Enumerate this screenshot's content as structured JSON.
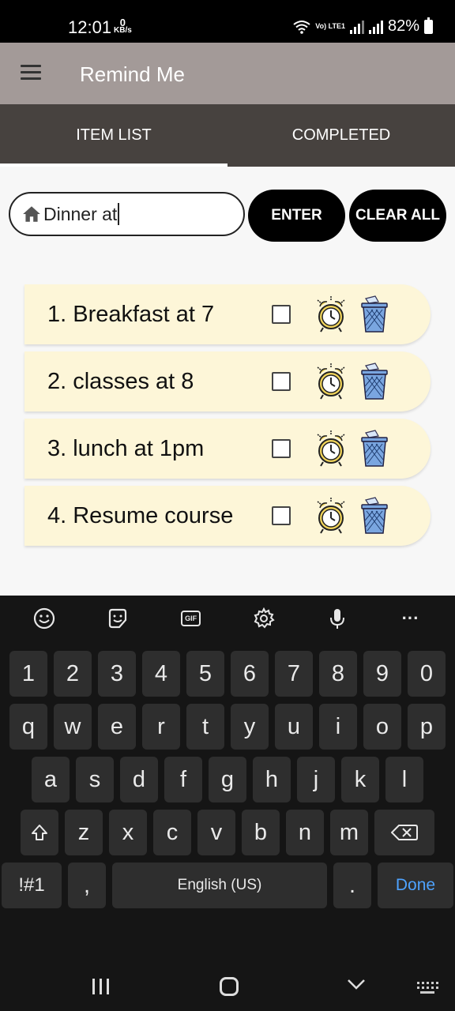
{
  "status_bar": {
    "time": "12:01",
    "net_speed_value": "0",
    "net_speed_unit": "KB/s",
    "volte_label": "Vo) LTE1",
    "battery": "82%"
  },
  "app_bar": {
    "title": "Remind Me",
    "menu_icon": "hamburger-menu-icon"
  },
  "tabs": [
    {
      "label": "ITEM LIST",
      "active": true
    },
    {
      "label": "COMPLETED",
      "active": false
    }
  ],
  "input": {
    "value": "Dinner at",
    "icon": "home-icon"
  },
  "buttons": {
    "enter": "ENTER",
    "clear_all": "CLEAR ALL"
  },
  "items": [
    {
      "text": "1. Breakfast at 7",
      "checked": false
    },
    {
      "text": "2. classes at 8",
      "checked": false
    },
    {
      "text": "3. lunch at 1pm",
      "checked": false
    },
    {
      "text": "4. Resume course",
      "checked": false
    }
  ],
  "keyboard": {
    "toolbar": [
      "emoji-icon",
      "sticker-icon",
      "gif-icon",
      "settings-icon",
      "microphone-icon",
      "more-icon"
    ],
    "gif_label": "GIF",
    "more_label": "···",
    "row1": [
      "1",
      "2",
      "3",
      "4",
      "5",
      "6",
      "7",
      "8",
      "9",
      "0"
    ],
    "row2": [
      "q",
      "w",
      "e",
      "r",
      "t",
      "y",
      "u",
      "i",
      "o",
      "p"
    ],
    "row3": [
      "a",
      "s",
      "d",
      "f",
      "g",
      "h",
      "j",
      "k",
      "l"
    ],
    "row4": [
      "z",
      "x",
      "c",
      "v",
      "b",
      "n",
      "m"
    ],
    "symbols": "!#1",
    "comma": ",",
    "space": "English (US)",
    "period": ".",
    "done": "Done"
  },
  "colors": {
    "status_bar": "#000000",
    "app_bar": "#a39a98",
    "tabs": "#47423f",
    "item_bg": "#fdf6d8",
    "done_key": "#4ea3ff"
  }
}
